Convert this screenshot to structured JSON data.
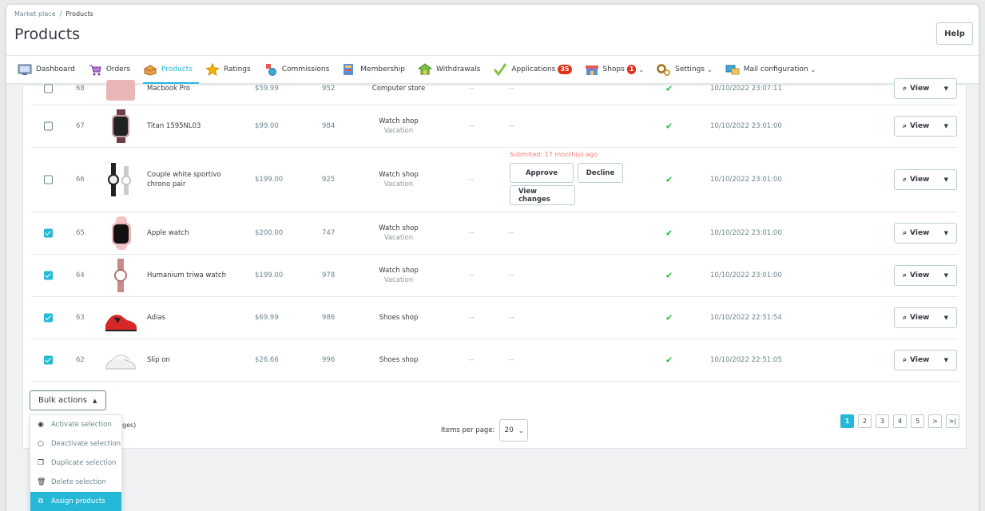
{
  "breadcrumb": {
    "parent": "Market place",
    "separator": "/",
    "current": "Products"
  },
  "page_title": "Products",
  "help_label": "Help",
  "tabs": [
    {
      "label": "Dashboard",
      "icon": "dashboard-icon"
    },
    {
      "label": "Orders",
      "icon": "orders-icon"
    },
    {
      "label": "Products",
      "icon": "products-icon",
      "active": true
    },
    {
      "label": "Ratings",
      "icon": "star-icon"
    },
    {
      "label": "Commissions",
      "icon": "commissions-icon"
    },
    {
      "label": "Membership",
      "icon": "membership-icon"
    },
    {
      "label": "Withdrawals",
      "icon": "withdrawals-icon"
    },
    {
      "label": "Applications",
      "icon": "applications-icon",
      "badge": "35"
    },
    {
      "label": "Shops",
      "icon": "shops-icon",
      "badge": "1",
      "dropdown": true
    },
    {
      "label": "Settings",
      "icon": "settings-icon",
      "dropdown": true
    },
    {
      "label": "Mail configuration",
      "icon": "mail-config-icon",
      "dropdown": true
    }
  ],
  "rows": [
    {
      "id": "68",
      "name": "Macbook Pro",
      "price": "$59.99",
      "qty": "952",
      "shop": "Computer store",
      "shop_sub": "",
      "col1": "--",
      "col2": "--",
      "date": "10/10/2022 23:07:11",
      "checked": false,
      "view_label": "View",
      "partial": true
    },
    {
      "id": "67",
      "name": "Titan 1595NL03",
      "price": "$99.00",
      "qty": "984",
      "shop": "Watch shop",
      "shop_sub": "Vacation",
      "col1": "--",
      "col2": "--",
      "date": "10/10/2022 23:01:00",
      "checked": false,
      "view_label": "View"
    },
    {
      "id": "66",
      "name": "Couple white sportivo chrono pair",
      "price": "$199.00",
      "qty": "925",
      "shop": "Watch shop",
      "shop_sub": "Vacation",
      "col1": "--",
      "col2": "",
      "date": "10/10/2022 23:01:00",
      "checked": false,
      "view_label": "View",
      "moderation": {
        "note": "Submited: 17 month(s) ago",
        "approve": "Approve",
        "decline": "Decline",
        "view_changes": "View changes"
      }
    },
    {
      "id": "65",
      "name": "Apple watch",
      "price": "$200.00",
      "qty": "747",
      "shop": "Watch shop",
      "shop_sub": "Vacation",
      "col1": "--",
      "col2": "--",
      "date": "10/10/2022 23:01:00",
      "checked": true,
      "view_label": "View"
    },
    {
      "id": "64",
      "name": "Humanium triwa watch",
      "price": "$199.00",
      "qty": "978",
      "shop": "Watch shop",
      "shop_sub": "Vacation",
      "col1": "--",
      "col2": "--",
      "date": "10/10/2022 23:01:00",
      "checked": true,
      "view_label": "View"
    },
    {
      "id": "63",
      "name": "Adias",
      "price": "$69.99",
      "qty": "986",
      "shop": "Shoes shop",
      "shop_sub": "",
      "col1": "--",
      "col2": "--",
      "date": "10/10/2022 22:51:54",
      "checked": true,
      "view_label": "View"
    },
    {
      "id": "62",
      "name": "Slip on",
      "price": "$26.66",
      "qty": "996",
      "shop": "Shoes shop",
      "shop_sub": "",
      "col1": "--",
      "col2": "--",
      "date": "10/10/2022 22:51:05",
      "checked": true,
      "view_label": "View"
    }
  ],
  "bulk": {
    "label": "Bulk actions",
    "menu": [
      {
        "label": "Activate selection",
        "icon": "radio-on-icon"
      },
      {
        "label": "Deactivate selection",
        "icon": "radio-off-icon"
      },
      {
        "label": "Duplicate selection",
        "icon": "duplicate-icon"
      },
      {
        "label": "Delete selection",
        "icon": "trash-icon"
      },
      {
        "label": "Assign products",
        "icon": "assign-icon",
        "highlighted": true
      }
    ]
  },
  "pages_text_fragment": "ges)",
  "items_per_page": {
    "label": "Items per page:",
    "value": "20"
  },
  "pagination": {
    "pages": [
      "1",
      "2",
      "3",
      "4",
      "5"
    ],
    "current": "1",
    "next": ">",
    "last": ">|"
  }
}
